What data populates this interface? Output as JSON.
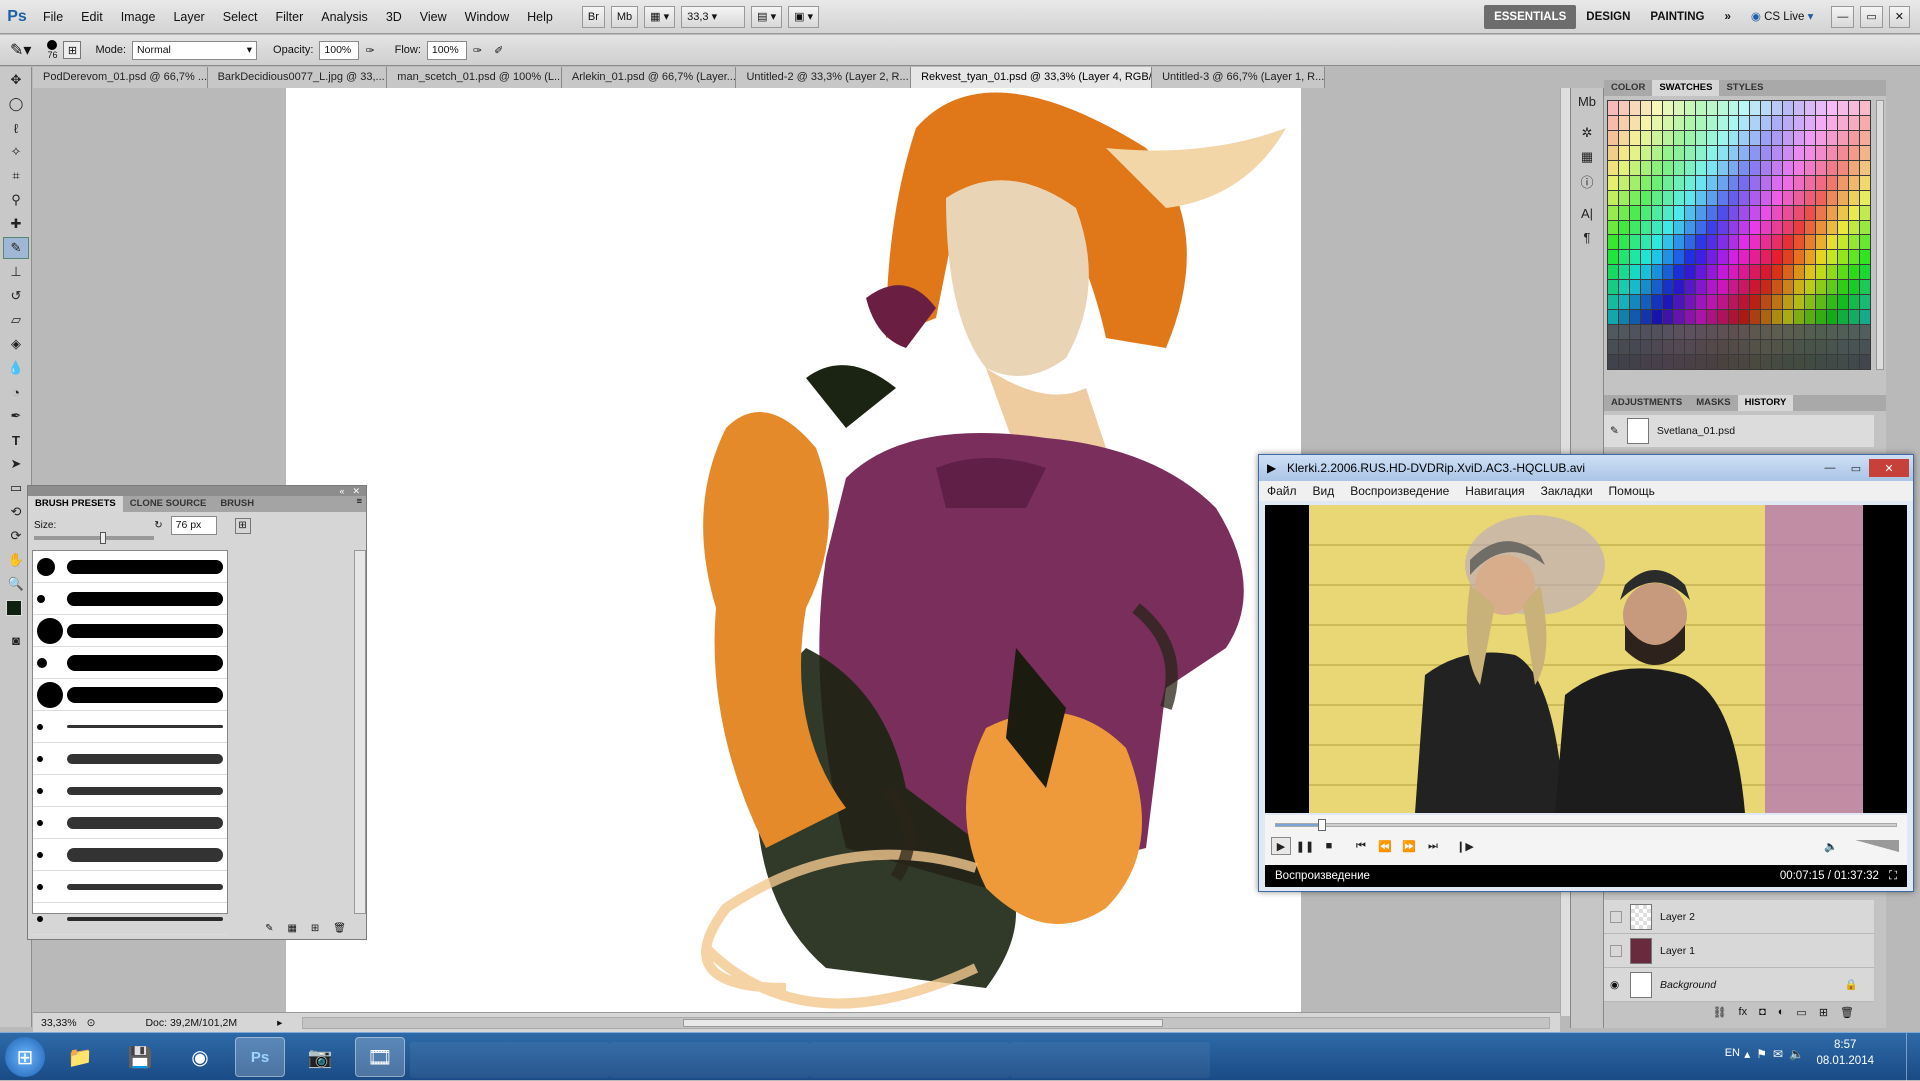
{
  "app": {
    "logo": "Ps",
    "menu": [
      "File",
      "Edit",
      "Image",
      "Layer",
      "Select",
      "Filter",
      "Analysis",
      "3D",
      "View",
      "Window",
      "Help"
    ],
    "zoom": "33,3",
    "workspaces": [
      "ESSENTIALS",
      "DESIGN",
      "PAINTING"
    ],
    "cslive": "CS Live"
  },
  "options": {
    "brush_size": "76",
    "mode_label": "Mode:",
    "mode_value": "Normal",
    "opacity_label": "Opacity:",
    "opacity_value": "100%",
    "flow_label": "Flow:",
    "flow_value": "100%"
  },
  "tabs": [
    "PodDerevom_01.psd @ 66,7% ...",
    "BarkDecidious0077_L.jpg @ 33,...",
    "man_scetch_01.psd @ 100% (L...",
    "Arlekin_01.psd @ 66,7% (Layer...",
    "Untitled-2 @ 33,3% (Layer 2, R...",
    "Rekvest_tyan_01.psd @ 33,3% (Layer 4, RGB/8) *",
    "Untitled-3 @ 66,7% (Layer 1, R..."
  ],
  "status": {
    "zoom": "33,33%",
    "doc": "Doc: 39,2M/101,2M"
  },
  "panels": {
    "color_tabs": [
      "COLOR",
      "SWATCHES",
      "STYLES"
    ],
    "history_tabs": [
      "ADJUSTMENTS",
      "MASKS",
      "HISTORY"
    ],
    "history_item": "Svetlana_01.psd",
    "layers": [
      "Layer 2",
      "Layer 1",
      "Background"
    ]
  },
  "brush_panel": {
    "tabs": [
      "BRUSH PRESETS",
      "CLONE SOURCE",
      "BRUSH"
    ],
    "size_label": "Size:",
    "size_value": "76 px"
  },
  "player": {
    "title": "Klerki.2.2006.RUS.HD-DVDRip.XviD.AC3.-HQCLUB.avi",
    "menu": [
      "Файл",
      "Вид",
      "Воспроизведение",
      "Навигация",
      "Закладки",
      "Помощь"
    ],
    "status_left": "Воспроизведение",
    "time": "00:07:15 / 01:37:32",
    "progress": 0.074
  },
  "taskbar": {
    "lang": "EN",
    "time": "8:57",
    "date": "08.01.2014"
  }
}
